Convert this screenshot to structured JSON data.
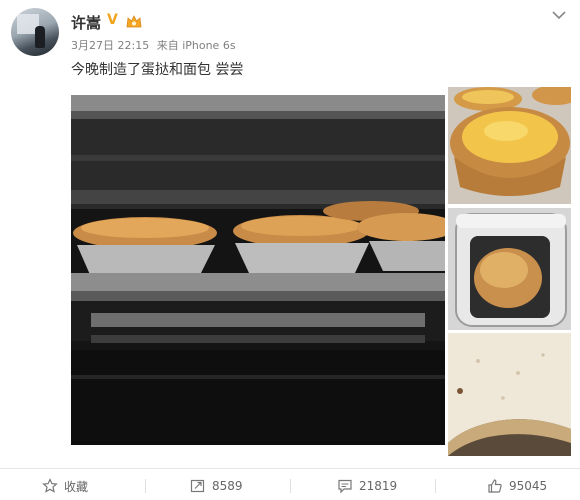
{
  "post": {
    "username": "许嵩",
    "verified_mark": "V",
    "timestamp": "3月27日 22:15",
    "source": "来自 iPhone 6s",
    "text": "今晚制造了蛋挞和面包 尝尝"
  },
  "actions": {
    "favorite_label": "收藏",
    "repost_count": "8589",
    "comment_count": "21819",
    "like_count": "95045"
  },
  "colors": {
    "verified": "#f0a51e",
    "text": "#333333",
    "meta": "#808080",
    "action": "#666666"
  },
  "icons": [
    "chevron-down-icon",
    "star-icon",
    "repost-icon",
    "comment-icon",
    "thumbs-up-icon",
    "vip-icon"
  ]
}
